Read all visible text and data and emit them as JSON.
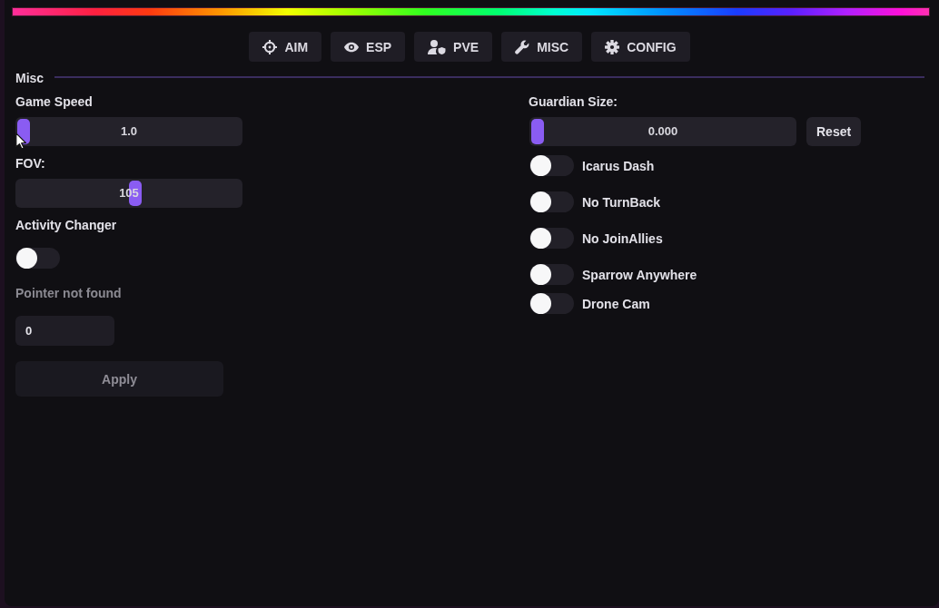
{
  "tabs": [
    {
      "label": "AIM"
    },
    {
      "label": "ESP"
    },
    {
      "label": "PVE"
    },
    {
      "label": "MISC"
    },
    {
      "label": "CONFIG"
    }
  ],
  "section": {
    "title": "Misc"
  },
  "game_speed": {
    "label": "Game Speed",
    "level": 0,
    "reading": "1.0"
  },
  "fov": {
    "label": "FOV:",
    "level": 0.53,
    "reading": "105"
  },
  "activity_changer": {
    "label": "Activity Changer",
    "on": false
  },
  "pointer_status": {
    "text": "Pointer not found"
  },
  "pointer_input": {
    "value": "0"
  },
  "apply_button": {
    "label": "Apply",
    "disabled": true
  },
  "guardian_size": {
    "label": "Guardian Size:",
    "level": 0,
    "reading": "0.000",
    "reset_button": "Reset"
  },
  "toggles": [
    {
      "label": "Icarus Dash",
      "on": false
    },
    {
      "label": "No TurnBack",
      "on": false
    },
    {
      "label": "No JoinAllies",
      "on": false
    },
    {
      "label": "Sparrow Anywhere",
      "on": false
    },
    {
      "label": "Drone Cam",
      "on": false
    }
  ]
}
